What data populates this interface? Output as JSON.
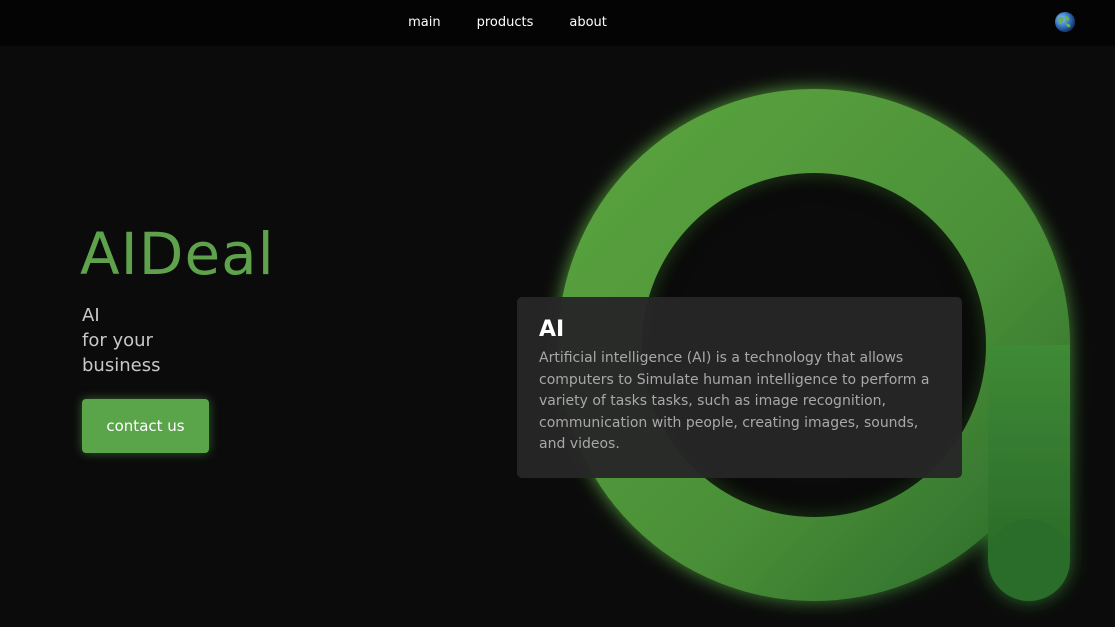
{
  "header": {
    "nav": [
      {
        "label": "main"
      },
      {
        "label": "products"
      },
      {
        "label": "about"
      }
    ],
    "globe_icon": "globe-icon"
  },
  "hero": {
    "title": "AIDeal",
    "subtitle_lines": [
      "AI",
      "for your",
      "business"
    ],
    "cta_label": "contact us"
  },
  "card": {
    "title": "AI",
    "text": "Artificial intelligence (AI) is a technology that allows computers to Simulate human intelligence to perform a variety of tasks tasks, such as image recognition, communication with people, creating images, sounds, and videos."
  },
  "colors": {
    "background": "#0b0b0b",
    "header": "#040404",
    "brand_green": "#5fa24c",
    "button_green": "#5aa44a",
    "card_bg": "#262626"
  }
}
